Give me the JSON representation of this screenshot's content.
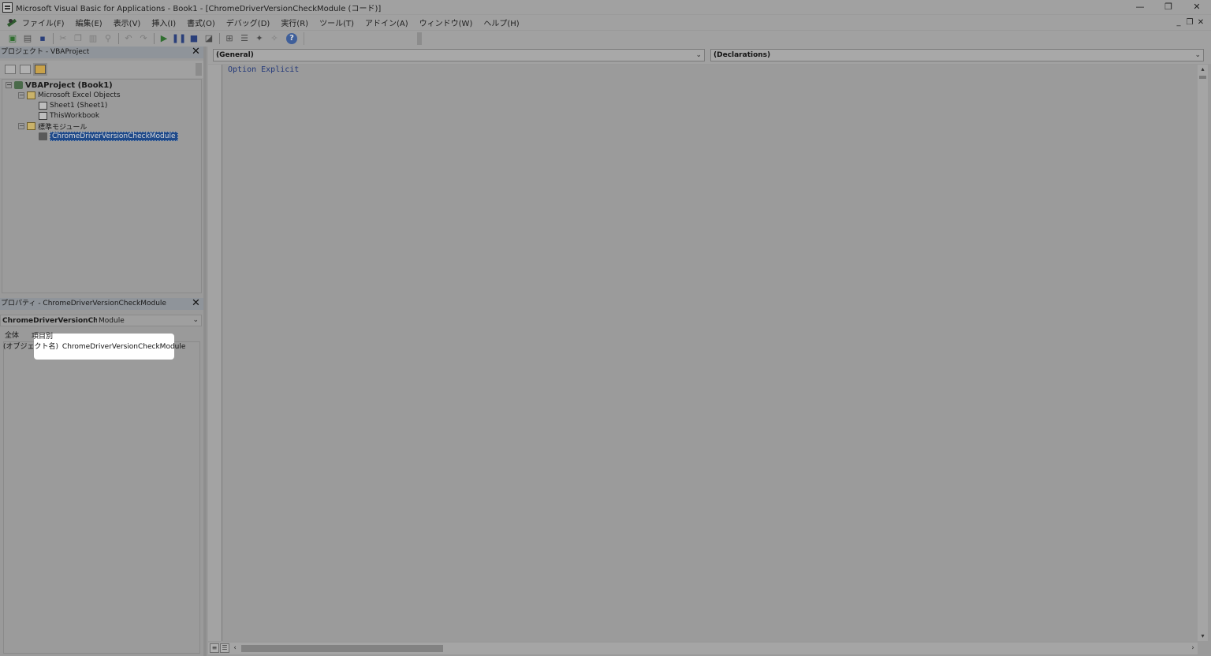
{
  "window": {
    "title": "Microsoft Visual Basic for Applications - Book1 - [ChromeDriverVersionCheckModule (コード)]",
    "controls": [
      "—",
      "❐",
      "✕"
    ],
    "mdi_controls": [
      "_",
      "❐",
      "✕"
    ]
  },
  "menu": {
    "items": [
      "ファイル(F)",
      "編集(E)",
      "表示(V)",
      "挿入(I)",
      "書式(O)",
      "デバッグ(D)",
      "実行(R)",
      "ツール(T)",
      "アドイン(A)",
      "ウィンドウ(W)",
      "ヘルプ(H)"
    ]
  },
  "toolbar": {
    "icons": [
      "view-excel-icon",
      "insert-module-icon",
      "save-icon",
      "cut-icon",
      "copy-icon",
      "paste-icon",
      "find-icon",
      "undo-icon",
      "redo-icon",
      "run-icon",
      "break-icon",
      "reset-icon",
      "design-mode-icon",
      "project-explorer-icon",
      "properties-window-icon",
      "object-browser-icon",
      "toolbox-icon",
      "help-icon"
    ]
  },
  "project_panel": {
    "title": "プロジェクト - VBAProject",
    "tree": {
      "root": "VBAProject (Book1)",
      "excel_objects_folder": "Microsoft Excel Objects",
      "sheet1": "Sheet1 (Sheet1)",
      "this_workbook": "ThisWorkbook",
      "modules_folder": "標準モジュール",
      "module": "ChromeDriverVersionCheckModule"
    }
  },
  "properties_panel": {
    "title": "プロパティ - ChromeDriverVersionCheckModule",
    "object_name": "ChromeDriverVersionChe",
    "object_type": "Module",
    "tabs": [
      "全体",
      "項目別"
    ],
    "row": {
      "name": "(オブジェクト名)",
      "value": "ChromeDriverVersionCheckModule"
    }
  },
  "code_window": {
    "object_combo": "(General)",
    "procedure_combo": "(Declarations)",
    "code": "Option Explicit"
  }
}
